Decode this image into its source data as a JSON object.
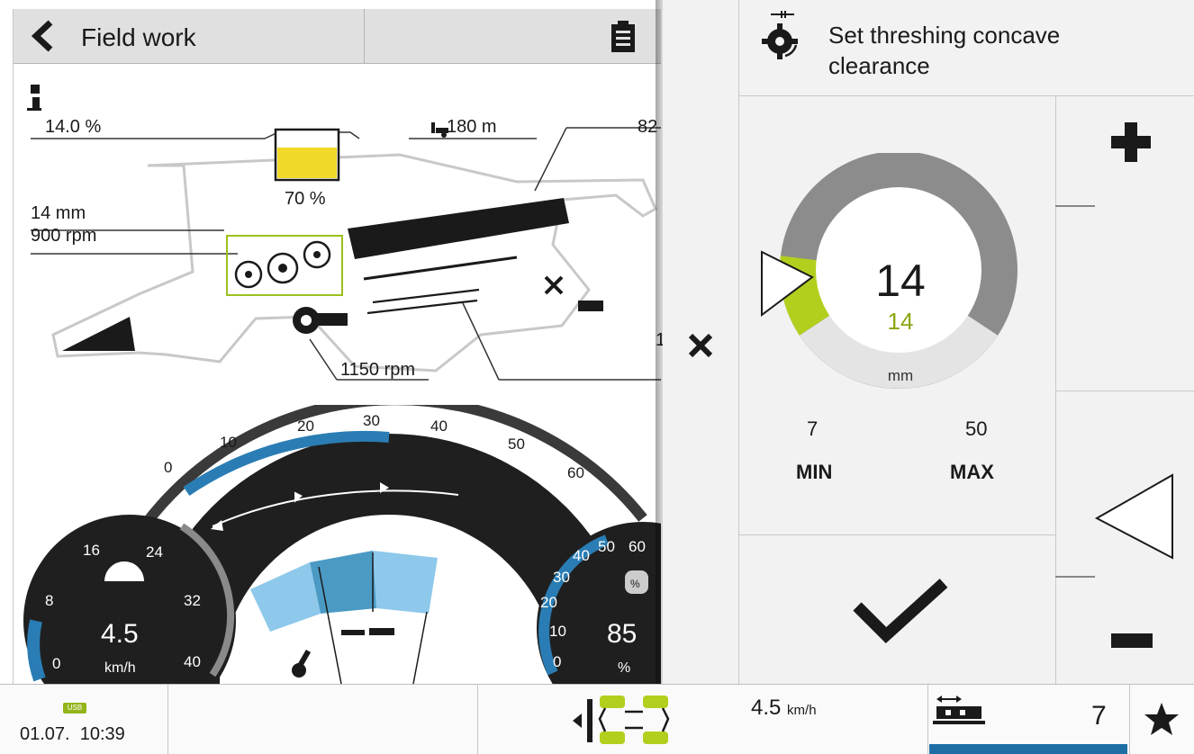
{
  "header": {
    "title": "Field work"
  },
  "machine": {
    "moisture": "14.0 %",
    "distance": "180 m",
    "right_value": "82",
    "grain_tank": "70 %",
    "concave_mm": "14 mm",
    "drum_rpm": "900 rpm",
    "fan_rpm": "1150 rpm",
    "edge_value": "1"
  },
  "dashboard": {
    "main_scale": [
      "0",
      "10",
      "20",
      "30",
      "40",
      "50",
      "60"
    ],
    "speed_scale": [
      "8",
      "16",
      "24",
      "32",
      "40",
      "0"
    ],
    "speed_value": "4.5",
    "speed_unit": "km/h",
    "load_scale": [
      "10",
      "20",
      "30",
      "40",
      "50",
      "60",
      "0"
    ],
    "load_value": "85",
    "load_unit": "%"
  },
  "panel": {
    "title": "Set threshing concave clearance",
    "current_value": "14",
    "set_value": "14",
    "unit": "mm",
    "min_value": "7",
    "max_value": "50",
    "min_label": "MIN",
    "max_label": "MAX",
    "level_fraction": 0.163
  },
  "status_bar": {
    "usb_label": "USB",
    "date": "01.07.",
    "time": "10:39",
    "speed": "4.5",
    "speed_unit": "km/h",
    "working_width": "7"
  },
  "colors": {
    "accent_green": "#b3cf1e",
    "accent_blue": "#2a7db4",
    "dark": "#1a1a1a"
  }
}
